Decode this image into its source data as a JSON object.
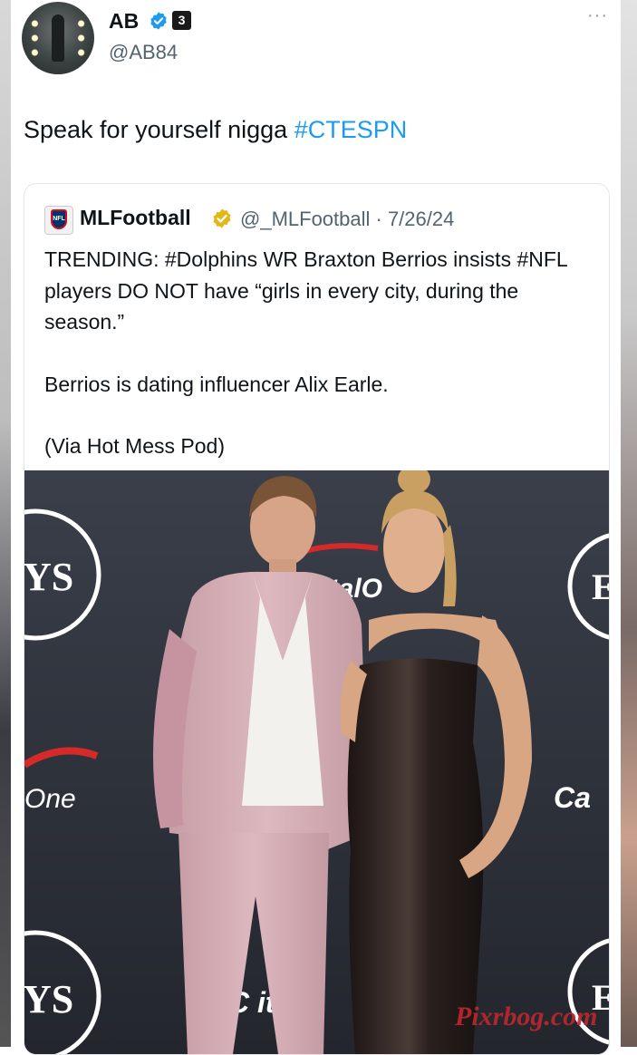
{
  "author": {
    "name": "AB",
    "handle": "@AB84",
    "badge_label": "3",
    "avatar_icon": "profile-avatar",
    "more_label": "···"
  },
  "tweet": {
    "text_prefix": "Speak for yourself nigga ",
    "hashtag": "#CTESPN",
    "hashtag_color": "#1d9bf0"
  },
  "quoted": {
    "name": "MLFootball",
    "handle_date": "@_MLFootball · 7/26/24",
    "paragraph1": "TRENDING: #Dolphins WR Braxton Berrios insists #NFL players DO NOT have “girls in every city, during the season.”",
    "paragraph2": "Berrios is dating influencer Alix Earle.",
    "paragraph3": "(Via Hot Mess Pod)",
    "avatar_label": "NFL"
  },
  "photo": {
    "backdrop_text": {
      "ys_top": "YS",
      "ys_bottom": "YS",
      "one": "One",
      "capital_right": "Ca",
      "capital_top": "pitalO",
      "capital_bottom": "C   ita",
      "e_top": "E",
      "e_bottom": "E"
    },
    "watermark": "Pixrbog.com"
  },
  "colors": {
    "verified_blue": "#1d9bf0",
    "verified_gold": "#e2b719",
    "handle_gray": "#536471"
  }
}
